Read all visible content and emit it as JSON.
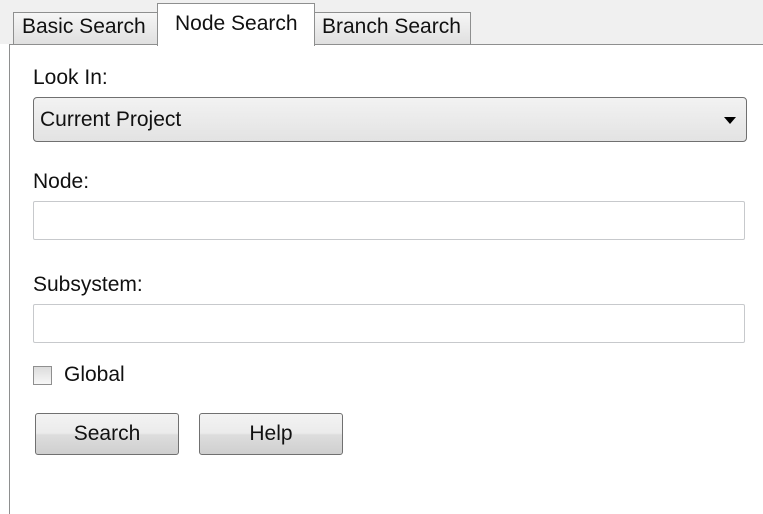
{
  "tabs": [
    {
      "label": "Basic Search",
      "active": false
    },
    {
      "label": "Node Search",
      "active": true
    },
    {
      "label": "Branch Search",
      "active": false
    }
  ],
  "look_in": {
    "label": "Look In:",
    "selected": "Current Project"
  },
  "node": {
    "label": "Node:",
    "value": ""
  },
  "subsystem": {
    "label": "Subsystem:",
    "value": ""
  },
  "global": {
    "label": "Global",
    "checked": false
  },
  "buttons": {
    "search": "Search",
    "help": "Help"
  }
}
